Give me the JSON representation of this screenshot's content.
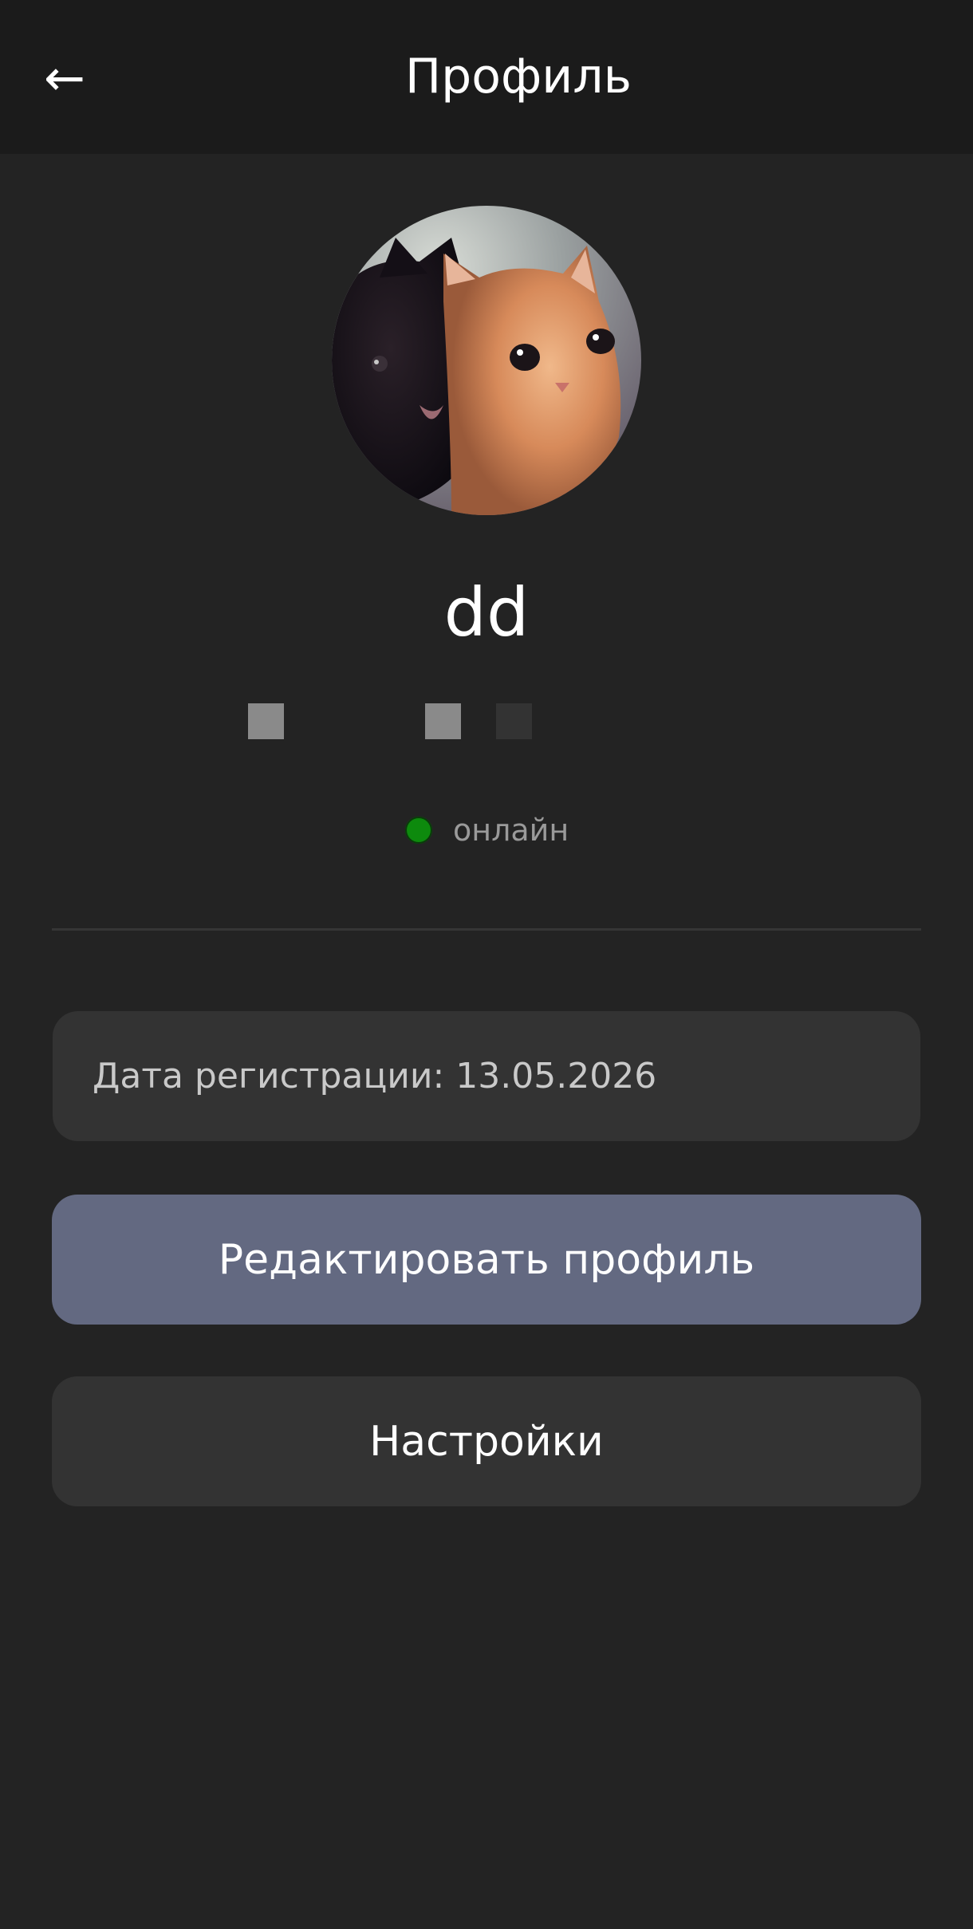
{
  "header": {
    "back_icon": "←",
    "title": "Профиль"
  },
  "profile": {
    "avatar_alt": "avatar",
    "username": "dd",
    "status_text": "онлайн",
    "status_color": "#0d8a0d"
  },
  "info": {
    "registration": "Дата регистрации: 13.05.2026"
  },
  "actions": {
    "edit_label": "Редактировать профиль",
    "settings_label": "Настройки"
  },
  "colors": {
    "background": "#232323",
    "header": "#1b1b1b",
    "card": "#333333",
    "accent_button": "#636981"
  }
}
